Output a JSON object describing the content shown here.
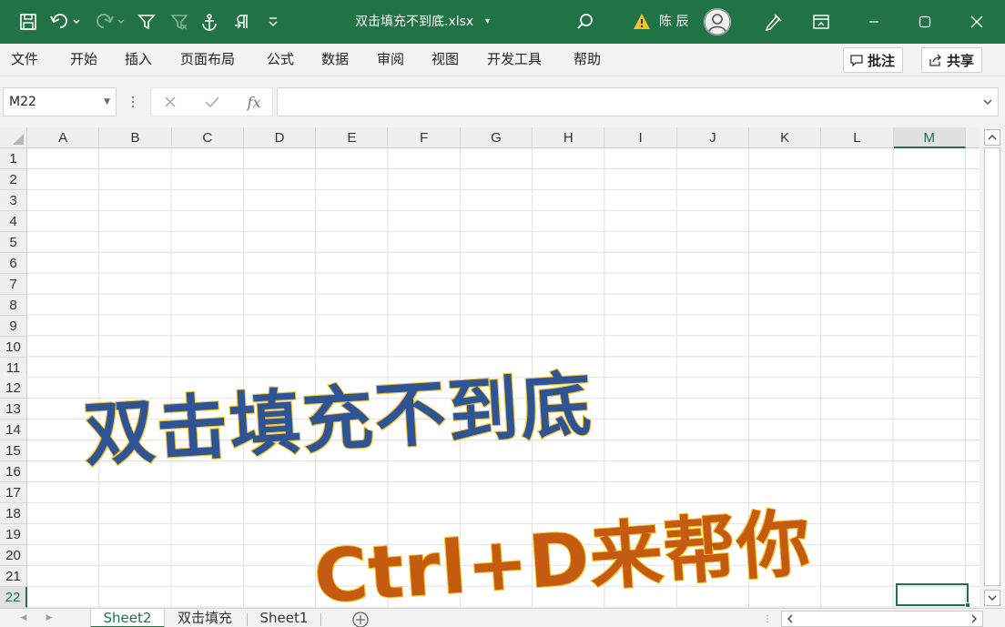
{
  "titlebar": {
    "filename": "双击填充不到底.xlsx",
    "caret": "▾",
    "user_name": "陈 辰",
    "accent_color": "#217346"
  },
  "quick_access": [
    {
      "icon": "save-icon"
    },
    {
      "icon": "undo-icon"
    },
    {
      "icon": "redo-icon"
    },
    {
      "icon": "filter-icon"
    },
    {
      "icon": "clear-filter-icon"
    },
    {
      "icon": "anchor-icon"
    },
    {
      "icon": "paragraph-icon"
    },
    {
      "icon": "customize-qat-icon"
    }
  ],
  "menu": {
    "items": [
      "文件",
      "开始",
      "插入",
      "页面布局",
      "公式",
      "数据",
      "审阅",
      "视图",
      "开发工具",
      "帮助"
    ],
    "comments_label": "批注",
    "share_label": "共享"
  },
  "formula_bar": {
    "name_box": "M22",
    "fx_label": "fx",
    "formula": ""
  },
  "grid": {
    "columns": [
      "A",
      "B",
      "C",
      "D",
      "E",
      "F",
      "G",
      "H",
      "I",
      "J",
      "K",
      "L",
      "M"
    ],
    "rows": [
      "1",
      "2",
      "3",
      "4",
      "5",
      "6",
      "7",
      "8",
      "9",
      "10",
      "11",
      "12",
      "13",
      "14",
      "15",
      "16",
      "17",
      "18",
      "19",
      "20",
      "21",
      "22"
    ],
    "selected_column": "M",
    "selected_row": "22"
  },
  "overlay": {
    "headline": "双击填充不到底",
    "subline": "Ctrl+D来帮你",
    "headline_color": "#2f5496",
    "subline_color": "#c55a11",
    "outline_color": "#f4c430"
  },
  "sheets": {
    "tabs": [
      "Sheet2",
      "双击填充",
      "Sheet1"
    ],
    "active": "Sheet2",
    "add_label": "+"
  }
}
